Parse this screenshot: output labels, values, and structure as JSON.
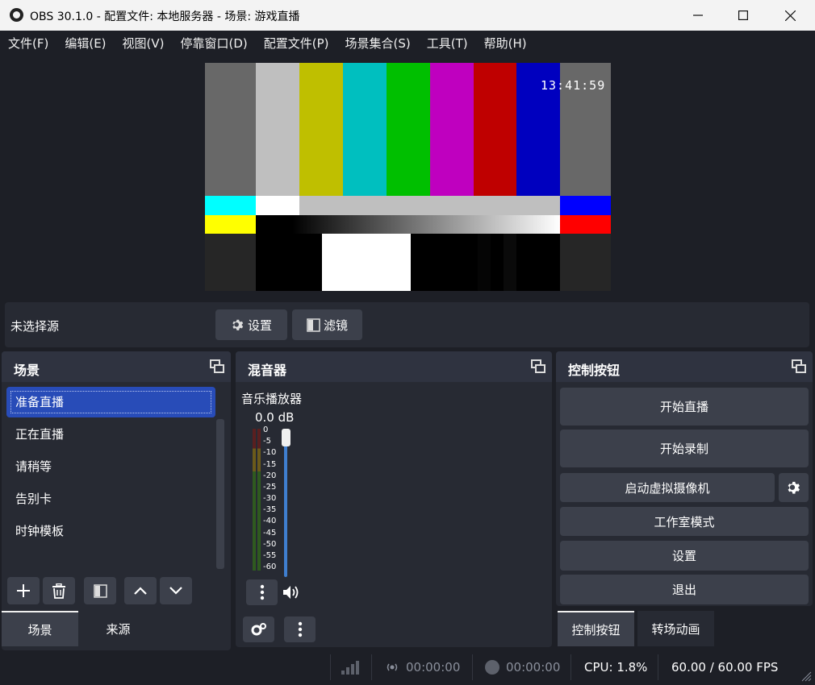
{
  "window": {
    "title": "OBS 30.1.0 - 配置文件: 本地服务器 - 场景: 游戏直播",
    "minimize": "—",
    "maximize": "☐",
    "close": "✕"
  },
  "menu": [
    "文件(F)",
    "编辑(E)",
    "视图(V)",
    "停靠窗口(D)",
    "配置文件(P)",
    "场景集合(S)",
    "工具(T)",
    "帮助(H)"
  ],
  "preview": {
    "timecode": "13:41:59"
  },
  "source_toolbar": {
    "no_source": "未选择源",
    "settings": "设置",
    "filters": "滤镜"
  },
  "scenes": {
    "title": "场景",
    "items": [
      "准备直播",
      "正在直播",
      "请稍等",
      "告别卡",
      "时钟模板"
    ],
    "selected_index": 0
  },
  "mixer": {
    "title": "混音器",
    "channel": "音乐播放器",
    "level": "0.0 dB",
    "ticks": [
      "0",
      "-5",
      "-10",
      "-15",
      "-20",
      "-25",
      "-30",
      "-35",
      "-40",
      "-45",
      "-50",
      "-55",
      "-60"
    ]
  },
  "controls": {
    "title": "控制按钮",
    "start_stream": "开始直播",
    "start_record": "开始录制",
    "virtual_cam": "启动虚拟摄像机",
    "studio_mode": "工作室模式",
    "settings": "设置",
    "exit": "退出"
  },
  "tabs": {
    "scenes": "场景",
    "sources": "来源",
    "controls": "控制按钮",
    "transitions": "转场动画"
  },
  "status": {
    "stream_time": "00:00:00",
    "record_time": "00:00:00",
    "cpu": "CPU: 1.8%",
    "fps": "60.00 / 60.00 FPS"
  },
  "colors": {
    "accent": "#284cb8",
    "panel": "#272a33",
    "header": "#2f3340",
    "button": "#3c404b",
    "background": "#1d1f26"
  }
}
